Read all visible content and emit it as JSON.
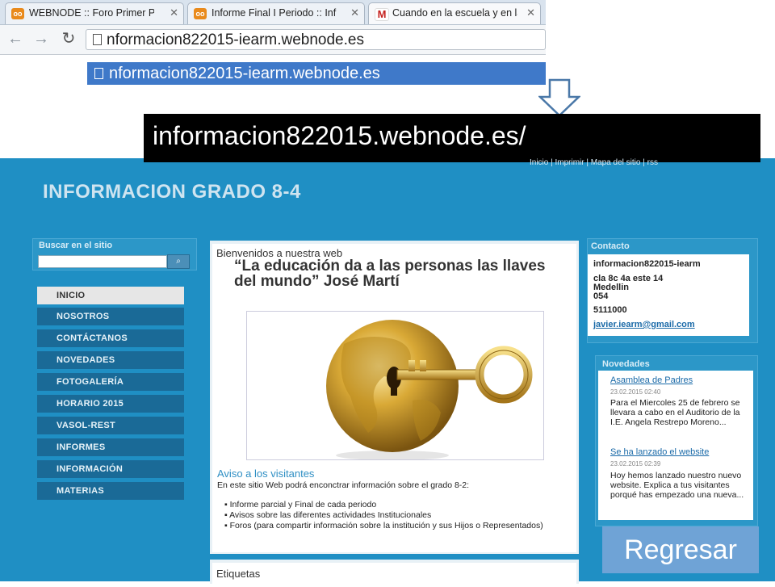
{
  "browser": {
    "tabs": [
      {
        "label": "WEBNODE :: Foro Primer Per",
        "favicon": "webnode-icon",
        "favicon_text": "oo"
      },
      {
        "label": "Informe Final I Periodo :: Inf",
        "favicon": "webnode-icon",
        "favicon_text": "oo"
      },
      {
        "label": "Cuando en la escuela y en la",
        "favicon": "gmail-icon",
        "favicon_text": "M"
      }
    ],
    "url": "nformacion822015-iearm.webnode.es",
    "suggestion": "nformacion822015-iearm.webnode.es"
  },
  "banner": {
    "text": "informacion822015.webnode.es/"
  },
  "site": {
    "top_links": "Inicio | Imprimir | Mapa del sitio | rss",
    "title": "INFORMACION GRADO 8-4",
    "search": {
      "label": "Buscar en el sitio",
      "placeholder": ""
    },
    "menu": [
      {
        "label": "INICIO",
        "active": true
      },
      {
        "label": "NOSOTROS",
        "active": false
      },
      {
        "label": "CONTÁCTANOS",
        "active": false
      },
      {
        "label": "NOVEDADES",
        "active": false
      },
      {
        "label": "FOTOGALERÍA",
        "active": false
      },
      {
        "label": "HORARIO 2015",
        "active": false
      },
      {
        "label": "VASOL-REST",
        "active": false
      },
      {
        "label": "INFORMES",
        "active": false
      },
      {
        "label": "INFORMACIÓN",
        "active": false
      },
      {
        "label": "MATERIAS",
        "active": false
      }
    ],
    "main": {
      "welcome": "Bienvenidos a nuestra web",
      "quote": "“La educación da a las personas las llaves del mundo” José Martí",
      "aviso_title": "Aviso a los visitantes",
      "aviso_text": "En este sitio Web podrá enconctrar información sobre el grado 8-2:",
      "aviso_items": [
        "Informe parcial y Final de cada periodo",
        "Avisos sobre las diferentes actividades Institucionales",
        "Foros (para compartir información sobre la institución y sus Hijos o Representados)"
      ],
      "etiquetas": "Etiquetas"
    },
    "contact": {
      "title": "Contacto",
      "name": "informacion822015-iearm",
      "address1": "cla 8c 4a este 14",
      "city": "Medellin",
      "code": "054",
      "phone": "5111000",
      "email": "javier.iearm@gmail.com"
    },
    "news": {
      "title": "Novedades",
      "items": [
        {
          "title": "Asamblea de Padres",
          "date": "23.02.2015 02:40",
          "text": "Para el Miercoles 25 de febrero se llevara a cabo en el Auditorio de la I.E. Angela Restrepo Moreno..."
        },
        {
          "title": "Se ha lanzado el website",
          "date": "23.02.2015 02:39",
          "text": "Hoy hemos lanzado nuestro nuevo website. Explica a tus visitantes porqué has empezado una nueva..."
        }
      ]
    }
  },
  "regresar": {
    "label": "Regresar"
  }
}
